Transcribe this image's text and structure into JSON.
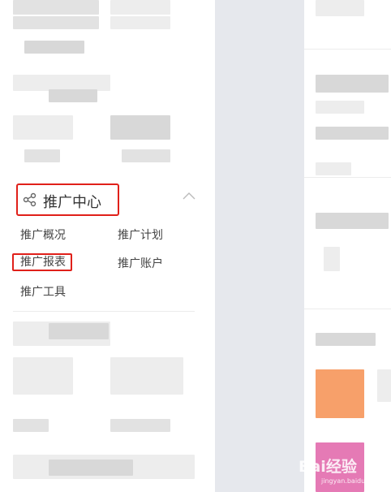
{
  "promotion": {
    "title": "推广中心",
    "items": [
      {
        "label": "推广概况"
      },
      {
        "label": "推广计划"
      },
      {
        "label": "推广报表"
      },
      {
        "label": "推广账户"
      },
      {
        "label": "推广工具"
      }
    ]
  },
  "icons": {
    "header": "share-icon",
    "collapse": "chevron-up-icon"
  },
  "colors": {
    "highlight": "#e0201a",
    "orange_thumb": "#f7a06a",
    "pink_thumb": "#e57ab5"
  },
  "watermark": {
    "text": "Bai经验",
    "sub": "jingyan.baidu.com"
  }
}
